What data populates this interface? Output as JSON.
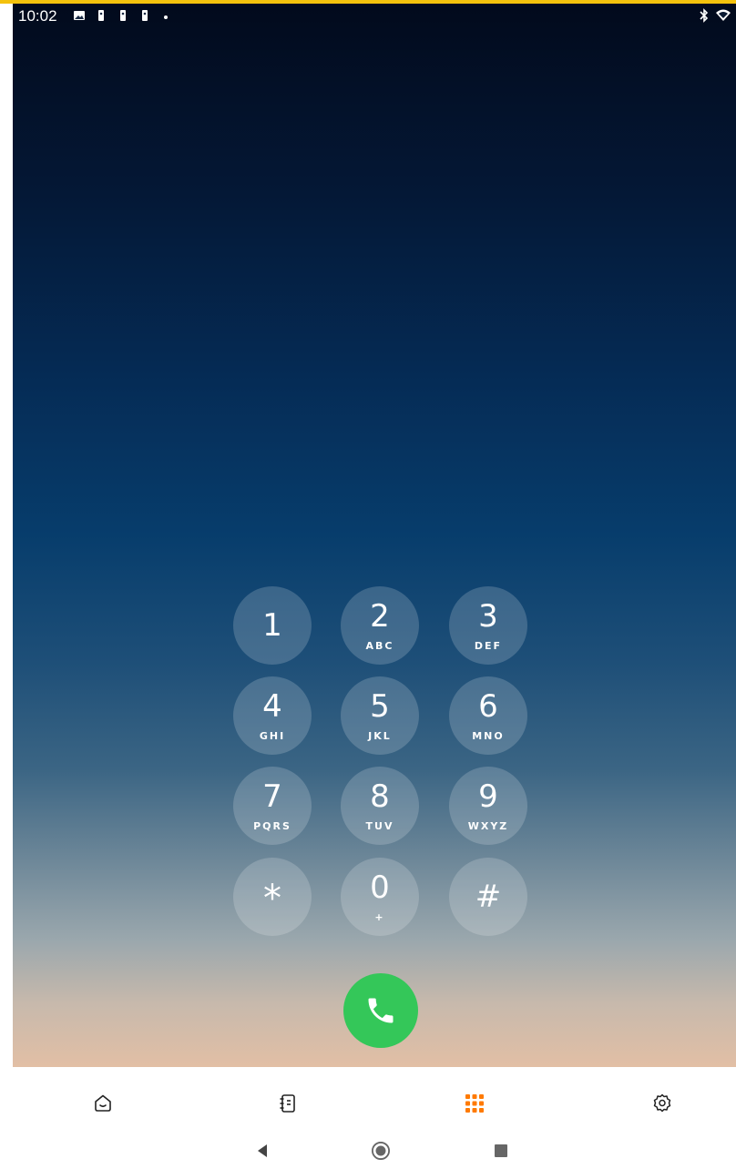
{
  "status_bar": {
    "time": "10:02",
    "icons_left": [
      "image-icon",
      "keyhole-icon",
      "keyhole-icon",
      "keyhole-icon",
      "dot-icon"
    ],
    "icons_right": [
      "bluetooth-icon",
      "wifi-icon"
    ]
  },
  "dialpad": {
    "keys": [
      {
        "digit": "1",
        "letters": ""
      },
      {
        "digit": "2",
        "letters": "ABC"
      },
      {
        "digit": "3",
        "letters": "DEF"
      },
      {
        "digit": "4",
        "letters": "GHI"
      },
      {
        "digit": "5",
        "letters": "JKL"
      },
      {
        "digit": "6",
        "letters": "MNO"
      },
      {
        "digit": "7",
        "letters": "PQRS"
      },
      {
        "digit": "8",
        "letters": "TUV"
      },
      {
        "digit": "9",
        "letters": "WXYZ"
      },
      {
        "digit": "*",
        "letters": ""
      },
      {
        "digit": "0",
        "letters": "+"
      },
      {
        "digit": "#",
        "letters": ""
      }
    ]
  },
  "call_button": {
    "icon": "phone-icon",
    "color": "#34c759"
  },
  "bottom_nav": {
    "items": [
      {
        "icon": "home-icon",
        "active": false
      },
      {
        "icon": "contacts-icon",
        "active": false
      },
      {
        "icon": "dialpad-icon",
        "active": true
      },
      {
        "icon": "settings-icon",
        "active": false
      }
    ],
    "active_color": "#ff7a00"
  },
  "system_nav": [
    "back-icon",
    "home-circle-icon",
    "recents-icon"
  ]
}
